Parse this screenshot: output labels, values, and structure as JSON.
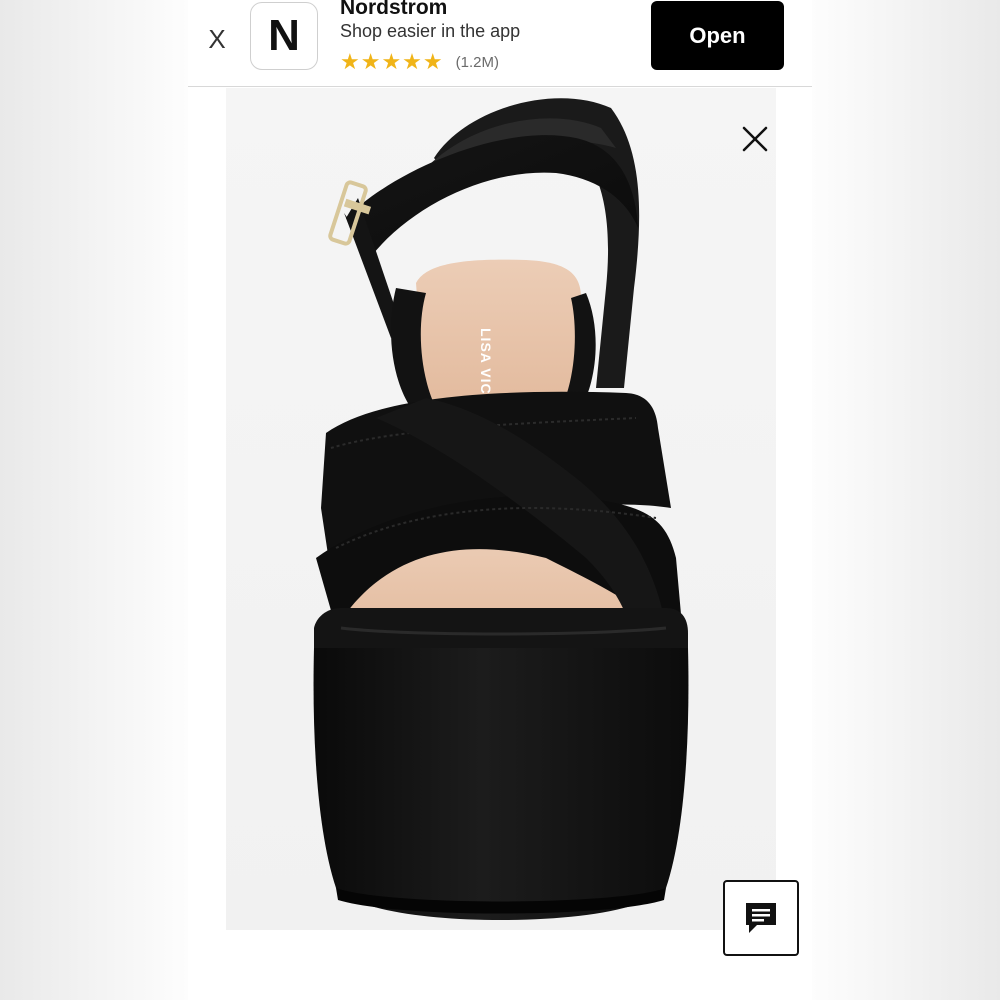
{
  "banner": {
    "dismiss_label": "X",
    "logo_letter": "N",
    "app_name": "Nordstrom",
    "tagline": "Shop easier in the app",
    "stars": "★★★★★",
    "rating_count": "(1.2M)",
    "open_label": "Open",
    "colors": {
      "star": "#f0b418",
      "open_bg": "#000000"
    }
  },
  "product": {
    "brand_on_insole": "LISA VICKY",
    "image": "black suede platform sandal, front view",
    "colors": {
      "suede": "#0e0e0e",
      "insole": "#e9c3a8"
    }
  },
  "icons": {
    "close": "close-icon",
    "chat": "chat-icon"
  }
}
